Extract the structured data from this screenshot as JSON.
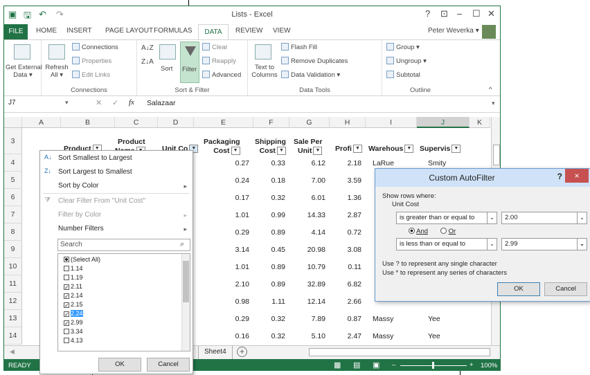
{
  "app": {
    "title": "Lists - Excel",
    "user": "Peter Weverka",
    "help": "?"
  },
  "tabs": [
    "FILE",
    "HOME",
    "INSERT",
    "PAGE LAYOUT",
    "FORMULAS",
    "DATA",
    "REVIEW",
    "VIEW"
  ],
  "ribbon": {
    "get_external": "Get External\nData ▾",
    "refresh": "Refresh\nAll ▾",
    "connections": "Connections",
    "properties": "Properties",
    "edit_links": "Edit Links",
    "connections_group": "Connections",
    "sort": "Sort",
    "filter": "Filter",
    "clear": "Clear",
    "reapply": "Reapply",
    "advanced": "Advanced",
    "sort_filter_group": "Sort & Filter",
    "text_to_columns": "Text to\nColumns",
    "flash_fill": "Flash Fill",
    "remove_duplicates": "Remove Duplicates",
    "data_validation": "Data Validation ▾",
    "data_tools_group": "Data Tools",
    "group": "Group ▾",
    "ungroup": "Ungroup ▾",
    "subtotal": "Subtotal",
    "outline_group": "Outline"
  },
  "formula_bar": {
    "name_box": "J7",
    "fx": "fx",
    "value": "Salazaar"
  },
  "columns": [
    "A",
    "B",
    "C",
    "D",
    "E",
    "F",
    "G",
    "H",
    "I",
    "J",
    "K"
  ],
  "header_row": {
    "row": "3",
    "product": "Product",
    "product_name": "Product\nName",
    "unit_cost": "Unit Co",
    "packaging": "Packaging\nCost",
    "shipping": "Shipping\nCost",
    "sale": "Sale Per\nUnit",
    "profit": "Profi",
    "warehouse": "Warehous",
    "supervisor": "Supervis"
  },
  "rows": [
    {
      "n": "4",
      "e": "0.27",
      "f": "0.33",
      "g": "6.12",
      "h": "2.18",
      "i": "LaRue",
      "j": "Smity"
    },
    {
      "n": "5",
      "e": "0.24",
      "f": "0.18",
      "g": "7.00",
      "h": "3.59",
      "i": "",
      "j": ""
    },
    {
      "n": "6",
      "e": "0.17",
      "f": "0.32",
      "g": "6.01",
      "h": "1.36",
      "i": "",
      "j": ""
    },
    {
      "n": "7",
      "e": "1.01",
      "f": "0.99",
      "g": "14.33",
      "h": "2.87",
      "i": "",
      "j": ""
    },
    {
      "n": "8",
      "e": "0.29",
      "f": "0.89",
      "g": "4.14",
      "h": "0.72",
      "i": "",
      "j": ""
    },
    {
      "n": "9",
      "e": "3.14",
      "f": "0.45",
      "g": "20.98",
      "h": "3.08",
      "i": "",
      "j": ""
    },
    {
      "n": "10",
      "e": "1.01",
      "f": "0.89",
      "g": "10.79",
      "h": "0.11",
      "i": "",
      "j": ""
    },
    {
      "n": "11",
      "e": "2.10",
      "f": "0.89",
      "g": "32.89",
      "h": "6.82",
      "i": "",
      "j": ""
    },
    {
      "n": "12",
      "e": "0.98",
      "f": "1.11",
      "g": "12.14",
      "h": "2.66",
      "i": "",
      "j": ""
    },
    {
      "n": "13",
      "e": "0.29",
      "f": "0.32",
      "g": "7.89",
      "h": "0.87",
      "i": "Massy",
      "j": "Yee"
    },
    {
      "n": "14",
      "e": "0.16",
      "f": "0.32",
      "g": "5.10",
      "h": "2.47",
      "i": "Massy",
      "j": "Yee"
    }
  ],
  "sheet_tab": "Sheet4",
  "status": {
    "ready": "READY",
    "zoom": "100%"
  },
  "filter_menu": {
    "sort_asc": "Sort Smallest to Largest",
    "sort_desc": "Sort Largest to Smallest",
    "sort_color": "Sort by Color",
    "clear": "Clear Filter From \"Unit Cost\"",
    "filter_color": "Filter by Color",
    "number_filters": "Number Filters",
    "search_placeholder": "Search",
    "items": [
      {
        "label": "(Select All)",
        "state": "partial"
      },
      {
        "label": "1.14",
        "state": "off"
      },
      {
        "label": "1.19",
        "state": "off"
      },
      {
        "label": "2.11",
        "state": "on"
      },
      {
        "label": "2.14",
        "state": "on"
      },
      {
        "label": "2.15",
        "state": "on"
      },
      {
        "label": "2.24",
        "state": "on"
      },
      {
        "label": "2.99",
        "state": "on"
      },
      {
        "label": "3.34",
        "state": "off"
      },
      {
        "label": "4.13",
        "state": "off"
      }
    ],
    "ok": "OK",
    "cancel": "Cancel"
  },
  "dialog": {
    "title": "Custom AutoFilter",
    "help": "?",
    "close": "×",
    "show_rows": "Show rows where:",
    "field": "Unit Cost",
    "op1": "is greater than or equal to",
    "val1": "2.00",
    "and": "And",
    "or": "Or",
    "op2": "is less than or equal to",
    "val2": "2.99",
    "hint1": "Use ? to represent any single character",
    "hint2": "Use * to represent any series of characters",
    "ok": "OK",
    "cancel": "Cancel"
  }
}
